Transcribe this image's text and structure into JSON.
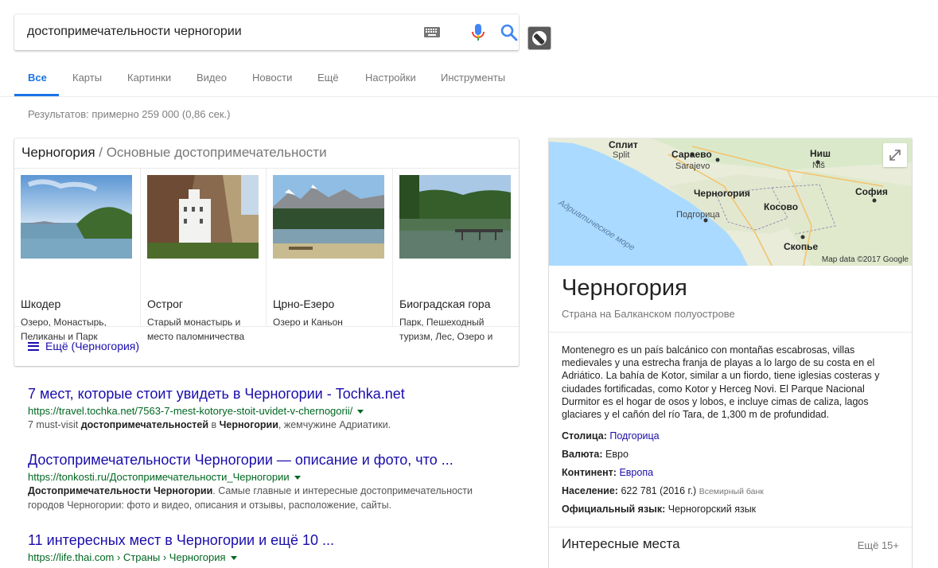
{
  "search": {
    "query": "достопримечательности черногории"
  },
  "tabs": [
    "Все",
    "Карты",
    "Картинки",
    "Видео",
    "Новости",
    "Ещё",
    "Настройки",
    "Инструменты"
  ],
  "stats": "Результатов: примерно 259 000 (0,86 сек.)",
  "attractions": {
    "heading": "Черногория",
    "heading_sub": "/ Основные достопримечательности",
    "items": [
      {
        "name": "Шкодер",
        "desc": "Озеро, Монастырь, Пеликаны и Парк"
      },
      {
        "name": "Острог",
        "desc": "Старый монастырь и место паломничества"
      },
      {
        "name": "Црно-Езеро",
        "desc": "Озеро и Каньон"
      },
      {
        "name": "Биоградская гора",
        "desc": "Парк, Пешеходный туризм, Лес, Озеро и"
      }
    ],
    "more": "Ещё (Черногория)"
  },
  "results": [
    {
      "title": "7 мест, которые стоит увидеть в Черногории - Tochka.net",
      "url": "https://travel.tochka.net/7563-7-mest-kotorye-stoit-uvidet-v-chernogorii/",
      "snippet_pre": "7 must-visit ",
      "snippet_b1": "достопримечательностей",
      "snippet_mid": " в ",
      "snippet_b2": "Черногории",
      "snippet_post": ", жемчужине Адриатики."
    },
    {
      "title": "Достопримечательности Черногории — описание и фото, что ...",
      "url": "https://tonkosti.ru/Достопримечательности_Черногории",
      "snippet_b1": "Достопримечательности",
      "snippet_mid": " ",
      "snippet_b2": "Черногории",
      "snippet_post": ". Самые главные и интересные достопримечательности городов Черногории: фото и видео, описания и отзывы, расположение, сайты."
    },
    {
      "title": "11 интересных мест в Черногории и ещё 10 ...",
      "url": "https://life.thai.com › Страны › Черногория"
    }
  ],
  "knowledge_panel": {
    "map_labels": {
      "split": "Сплит",
      "split_lat": "Split",
      "sarajevo": "Сараево",
      "sarajevo_lat": "Sarajevo",
      "nis": "Ниш",
      "nis_lat": "Niš",
      "montenegro": "Черногория",
      "podgorica": "Подгорица",
      "kosovo": "Косово",
      "sofia": "София",
      "skopje": "Скопье",
      "adriatic": "Адриатическое море"
    },
    "map_credit": "Map data ©2017 Google",
    "title": "Черногория",
    "subtitle": "Страна на Балканском полуострове",
    "description": "Montenegro es un país balcánico con montañas escabrosas, villas medievales y una estrecha franja de playas a lo largo de su costa en el Adriático. La bahía de Kotor, similar a un fiordo, tiene iglesias costeras y ciudades fortificadas, como Kotor y Herceg Novi. El Parque Nacional Durmitor es el hogar de osos y lobos, e incluye cimas de caliza, lagos glaciares y el cañón del río Tara, de 1,300 m de profundidad.",
    "facts": {
      "capital_label": "Столица:",
      "capital_value": "Подгорица",
      "currency_label": "Валюта:",
      "currency_value": "Евро",
      "continent_label": "Континент:",
      "continent_value": "Европа",
      "population_label": "Население:",
      "population_value": "622 781 (2016 г.)",
      "population_source": "Всемирный банк",
      "language_label": "Официальный язык:",
      "language_value": "Черногорский язык"
    },
    "section_title": "Интересные места",
    "section_more": "Ещё 15+"
  },
  "colors": {
    "accent": "#1a73e8",
    "link": "#1a0dab",
    "url_green": "#006621"
  }
}
